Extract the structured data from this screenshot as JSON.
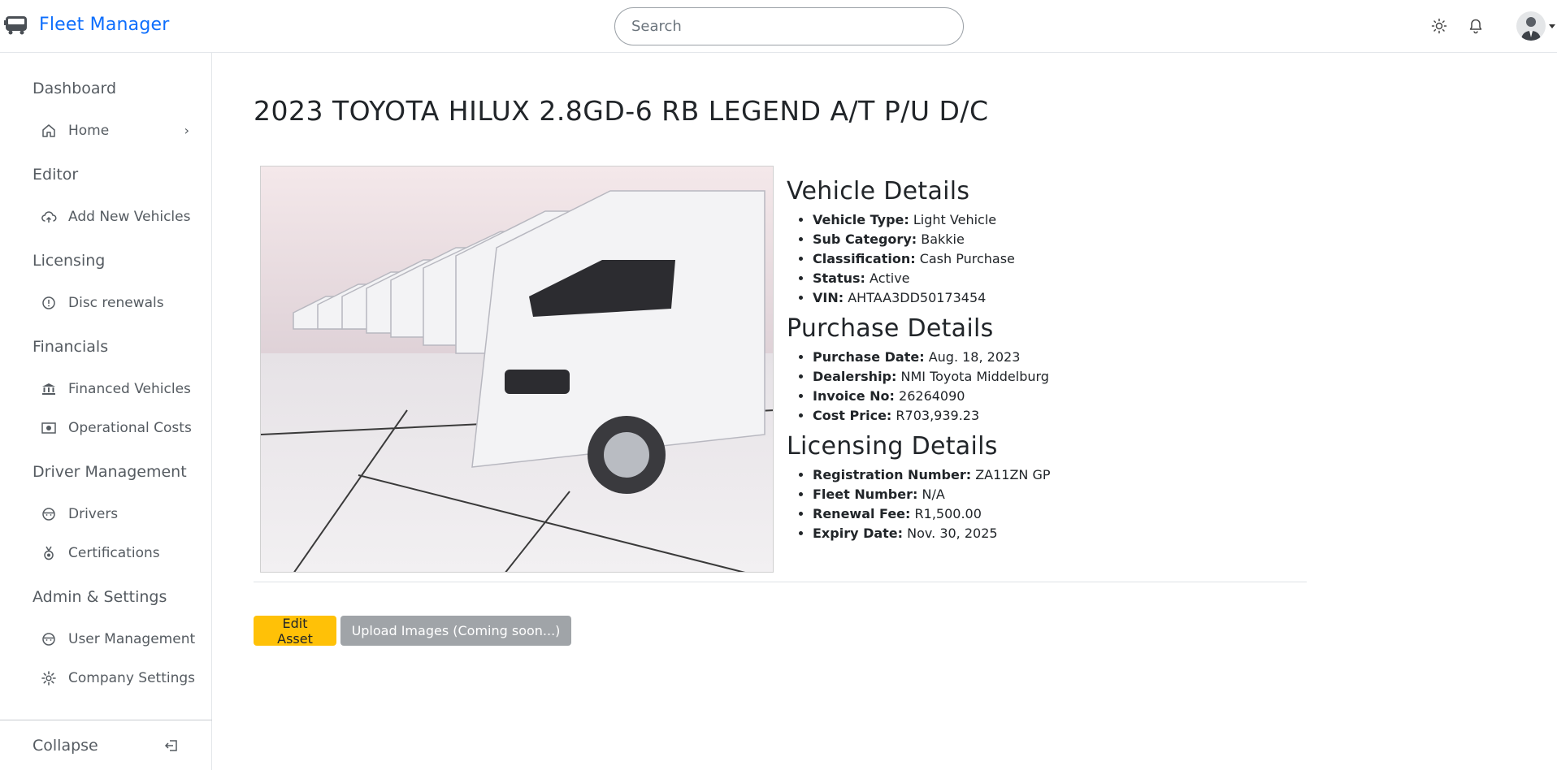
{
  "app": {
    "title": "Fleet Manager"
  },
  "search": {
    "placeholder": "Search"
  },
  "header_icons": [
    "sun-icon",
    "bell-icon",
    "avatar"
  ],
  "sidebar": {
    "sections": [
      {
        "title": "Dashboard",
        "items": [
          {
            "label": "Home",
            "icon": "home-icon",
            "chevron": "›"
          }
        ]
      },
      {
        "title": "Editor",
        "items": [
          {
            "label": "Add New Vehicles",
            "icon": "cloud-upload-icon"
          }
        ]
      },
      {
        "title": "Licensing",
        "items": [
          {
            "label": "Disc renewals",
            "icon": "alarm-icon"
          }
        ]
      },
      {
        "title": "Financials",
        "items": [
          {
            "label": "Financed Vehicles",
            "icon": "bank-icon"
          },
          {
            "label": "Operational Costs",
            "icon": "cash-icon"
          }
        ]
      },
      {
        "title": "Driver Management",
        "items": [
          {
            "label": "Drivers",
            "icon": "driver-face-icon"
          },
          {
            "label": "Certifications",
            "icon": "medal-icon"
          }
        ]
      },
      {
        "title": "Admin & Settings",
        "items": [
          {
            "label": "User Management",
            "icon": "user-face-icon"
          },
          {
            "label": "Company Settings",
            "icon": "gear-icon"
          }
        ]
      }
    ],
    "collapse_label": "Collapse"
  },
  "vehicle": {
    "title": "2023 TOYOTA HILUX 2.8GD-6 RB LEGEND A/T P/U D/C",
    "vehicle_details": {
      "heading": "Vehicle Details",
      "rows": [
        {
          "label": "Vehicle Type:",
          "value": "Light Vehicle"
        },
        {
          "label": "Sub Category:",
          "value": "Bakkie"
        },
        {
          "label": "Classification:",
          "value": "Cash Purchase"
        },
        {
          "label": "Status:",
          "value": "Active"
        },
        {
          "label": "VIN:",
          "value": "AHTAA3DD50173454"
        }
      ]
    },
    "purchase_details": {
      "heading": "Purchase Details",
      "rows": [
        {
          "label": "Purchase Date:",
          "value": "Aug. 18, 2023"
        },
        {
          "label": "Dealership:",
          "value": "NMI Toyota Middelburg"
        },
        {
          "label": "Invoice No:",
          "value": "26264090"
        },
        {
          "label": "Cost Price:",
          "value": "R703,939.23"
        }
      ]
    },
    "licensing_details": {
      "heading": "Licensing Details",
      "rows": [
        {
          "label": "Registration Number:",
          "value": "ZA11ZN GP"
        },
        {
          "label": "Fleet Number:",
          "value": "N/A"
        },
        {
          "label": "Renewal Fee:",
          "value": "R1,500.00"
        },
        {
          "label": "Expiry Date:",
          "value": "Nov. 30, 2025"
        }
      ]
    }
  },
  "actions": {
    "edit_label": "Edit Asset",
    "upload_label": "Upload Images (Coming soon...)"
  },
  "colors": {
    "brand": "#0d6efd",
    "edit_button": "#ffc107",
    "upload_button": "#a0a4a8"
  }
}
